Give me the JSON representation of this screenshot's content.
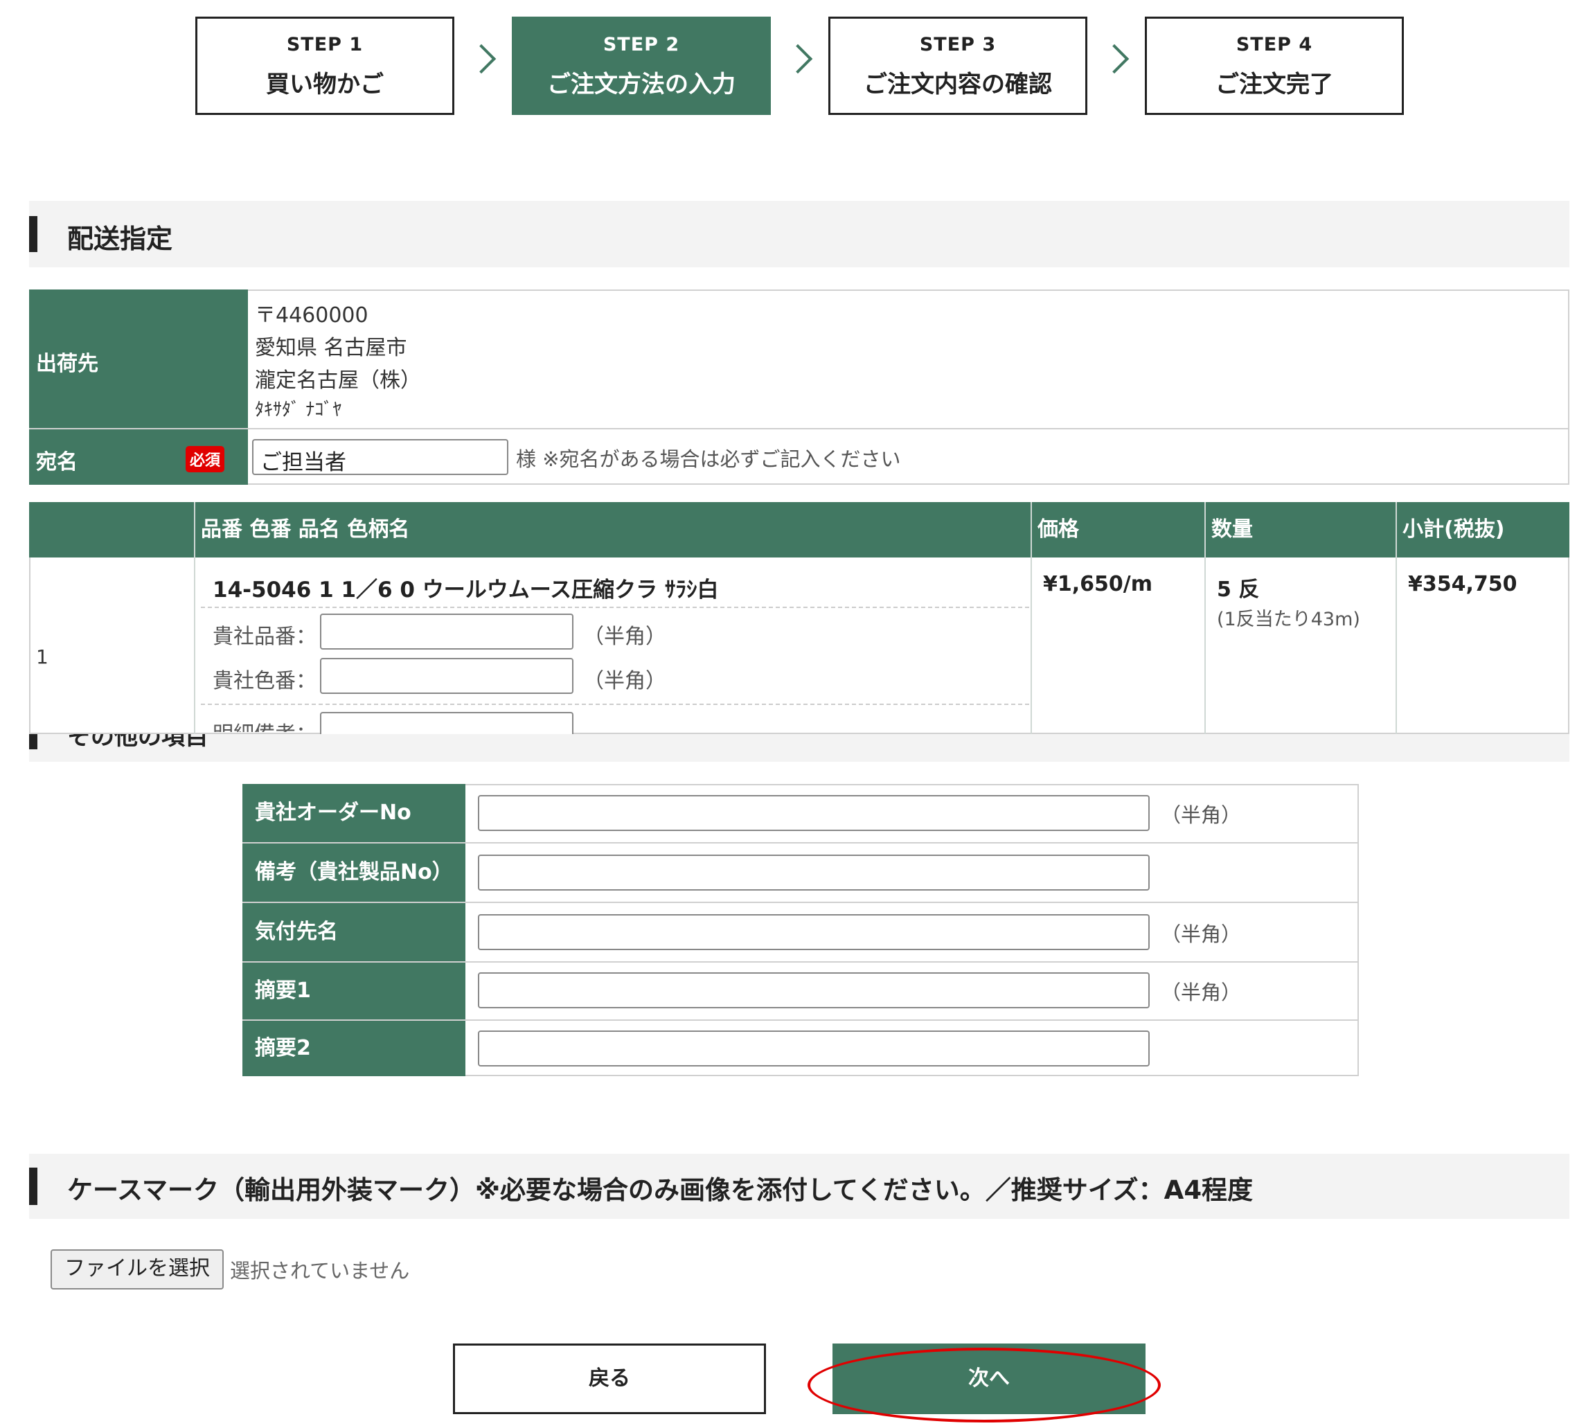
{
  "steps": [
    {
      "num": "STEP 1",
      "label": "買い物かご"
    },
    {
      "num": "STEP 2",
      "label": "ご注文方法の入力"
    },
    {
      "num": "STEP 3",
      "label": "ご注文内容の確認"
    },
    {
      "num": "STEP 4",
      "label": "ご注文完了"
    }
  ],
  "delivery": {
    "section_title": "配送指定",
    "ship_to_label": "出荷先",
    "address": [
      "〒4460000",
      "愛知県 名古屋市",
      "瀧定名古屋（株）",
      "ﾀｷｻﾀﾞ ﾅｺﾞﾔ"
    ],
    "recipient_label": "宛名",
    "required_badge": "必須",
    "recipient_value": "ご担当者",
    "recipient_note": "様 ※宛名がある場合は必ずご記入ください"
  },
  "items": {
    "headers": [
      "品番 色番 品名 色柄名",
      "価格",
      "数量",
      "小計(税抜)"
    ],
    "row": {
      "index": "1",
      "name": "14-5046 1 1／6 0 ウールウムース圧縮クラ ｻﾗｼ白",
      "price": "¥1,650/m",
      "qty": "5 反",
      "qty_note": "(1反当たり43m)",
      "subtotal": "¥354,750",
      "your_part_label": "貴社品番：",
      "your_color_label": "貴社色番：",
      "detail_note_label": "明細備考：",
      "hankaku": "（半角）"
    }
  },
  "other": {
    "section_title": "その他の項目",
    "rows": [
      {
        "label": "貴社オーダーNo",
        "note": "（半角）"
      },
      {
        "label": "備考（貴社製品No）",
        "note": ""
      },
      {
        "label": "気付先名",
        "note": "（半角）"
      },
      {
        "label": "摘要1",
        "note": "（半角）"
      },
      {
        "label": "摘要2",
        "note": ""
      }
    ]
  },
  "casemark": {
    "section_title": "ケースマーク（輸出用外装マーク）※必要な場合のみ画像を添付してください。／推奨サイズ：A4程度",
    "file_button": "ファイルを選択",
    "file_status": "選択されていません"
  },
  "buttons": {
    "back": "戻る",
    "next": "次へ"
  },
  "colors": {
    "brand": "#417862",
    "required": "#e00000",
    "highlight": "#e00000"
  }
}
